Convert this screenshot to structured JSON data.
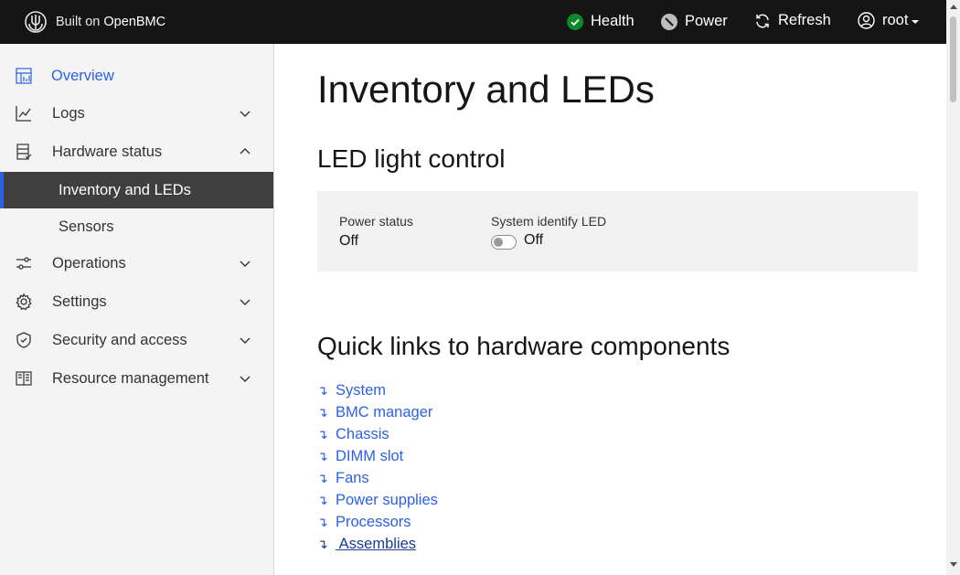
{
  "header": {
    "brand_prefix": "Built on",
    "brand_name": "OpenBMC",
    "health_label": "Health",
    "power_label": "Power",
    "refresh_label": "Refresh",
    "user_label": "root",
    "health_color": "#0a8a2a"
  },
  "sidebar": {
    "items": [
      {
        "label": "Overview",
        "icon": "dashboard-icon"
      },
      {
        "label": "Logs",
        "icon": "chart-line-icon"
      },
      {
        "label": "Hardware status",
        "icon": "server-icon"
      },
      {
        "label": "Operations",
        "icon": "sliders-icon"
      },
      {
        "label": "Settings",
        "icon": "gear-icon"
      },
      {
        "label": "Security and access",
        "icon": "shield-icon"
      },
      {
        "label": "Resource management",
        "icon": "book-icon"
      }
    ],
    "hardware_sub": [
      {
        "label": "Inventory and LEDs"
      },
      {
        "label": "Sensors"
      }
    ],
    "active_color": "#2d60e5"
  },
  "main": {
    "title": "Inventory and LEDs",
    "led_section_title": "LED light control",
    "power_status_label": "Power status",
    "power_status_value": "Off",
    "identify_led_label": "System identify LED",
    "identify_led_value": "Off",
    "identify_led_on": false,
    "quick_links_title": "Quick links to hardware components",
    "quick_links": [
      {
        "label": "System"
      },
      {
        "label": "BMC manager"
      },
      {
        "label": "Chassis"
      },
      {
        "label": "DIMM slot"
      },
      {
        "label": "Fans"
      },
      {
        "label": "Power supplies"
      },
      {
        "label": "Processors"
      },
      {
        "label": " Assemblies"
      }
    ],
    "link_arrow": "↴"
  }
}
